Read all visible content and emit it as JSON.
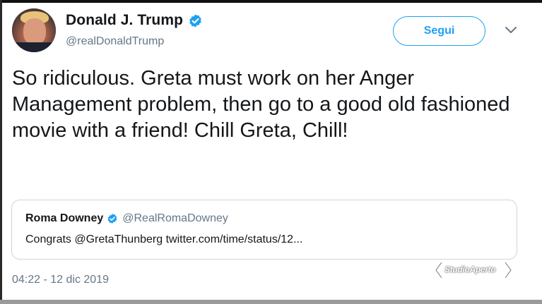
{
  "tweet": {
    "author_name": "Donald J. Trump",
    "author_handle": "@realDonaldTrump",
    "follow_label": "Segui",
    "text": "So ridiculous. Greta must work on her Anger Management problem, then go to a good old fashioned movie with a friend! Chill Greta, Chill!",
    "timestamp": "04:22 - 12 dic 2019"
  },
  "quoted_tweet": {
    "author_name": "Roma Downey",
    "author_handle": "@RealRomaDowney",
    "text": "Congrats @GretaThunberg twitter.com/time/status/12..."
  },
  "watermark": {
    "label": "StudioAperto"
  },
  "icons": {
    "verified": "verified-badge-icon",
    "chevron": "chevron-down-icon"
  },
  "colors": {
    "accent": "#1da1f2",
    "text_primary": "#14171a",
    "text_secondary": "#657786",
    "border": "#ccd6dd"
  }
}
